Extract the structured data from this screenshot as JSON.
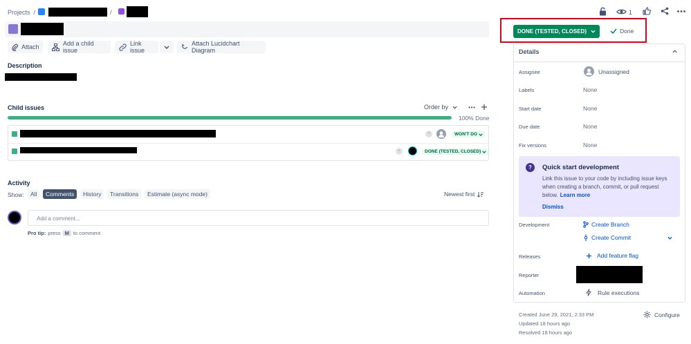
{
  "breadcrumb": {
    "root": "Projects",
    "sep1": "/",
    "sep2": "/"
  },
  "header_actions": {
    "watch_count": "1"
  },
  "toolbar": {
    "attach": "Attach",
    "add_child": "Add a child issue",
    "link_issue": "Link issue",
    "lucidchart": "Attach Lucidchart Diagram"
  },
  "description": {
    "heading": "Description"
  },
  "child_issues": {
    "heading": "Child issues",
    "order_by": "Order by",
    "progress_pct": 100,
    "progress_label": "100% Done",
    "rows": [
      {
        "badge": "-",
        "status": "WON'T DO"
      },
      {
        "badge": "-",
        "status": "DONE (TESTED, CLOSED)"
      }
    ]
  },
  "activity": {
    "heading": "Activity",
    "show_label": "Show:",
    "tabs": [
      "All",
      "Comments",
      "History",
      "Transitions",
      "Estimate (async mode)"
    ],
    "active_tab": "Comments",
    "sort": "Newest first",
    "comment_placeholder": "Add a comment...",
    "tip_prefix": "Pro tip:",
    "tip_press": "press",
    "tip_key": "M",
    "tip_suffix": "to comment"
  },
  "status": {
    "button": "DONE (TESTED, CLOSED)",
    "resolution": "Done",
    "highlight_color": "#e0001a",
    "button_color": "#00875a"
  },
  "details": {
    "heading": "Details",
    "assignee_label": "Assignee",
    "assignee_value": "Unassigned",
    "labels_label": "Labels",
    "labels_value": "None",
    "start_label": "Start date",
    "start_value": "None",
    "due_label": "Due date",
    "due_value": "None",
    "fix_label": "Fix versions",
    "fix_value": "None",
    "quickstart_title": "Quick start development",
    "quickstart_body_1": "Link this issue to your code by including issue keys",
    "quickstart_body_2": "when creating a branch, commit, or pull request",
    "quickstart_body_3": "below.",
    "quickstart_learn": "Learn more",
    "quickstart_dismiss": "Dismiss",
    "development_label": "Development",
    "create_branch": "Create Branch",
    "create_commit": "Create Commit",
    "releases_label": "Releases",
    "add_flag": "Add feature flag",
    "reporter_label": "Reporter",
    "automation_label": "Automation",
    "rule_exec": "Rule executions"
  },
  "footer": {
    "created": "Created June 29, 2021, 2:33 PM",
    "updated": "Updated 18 hours ago",
    "resolved": "Resolved 18 hours ago",
    "configure": "Configure"
  }
}
